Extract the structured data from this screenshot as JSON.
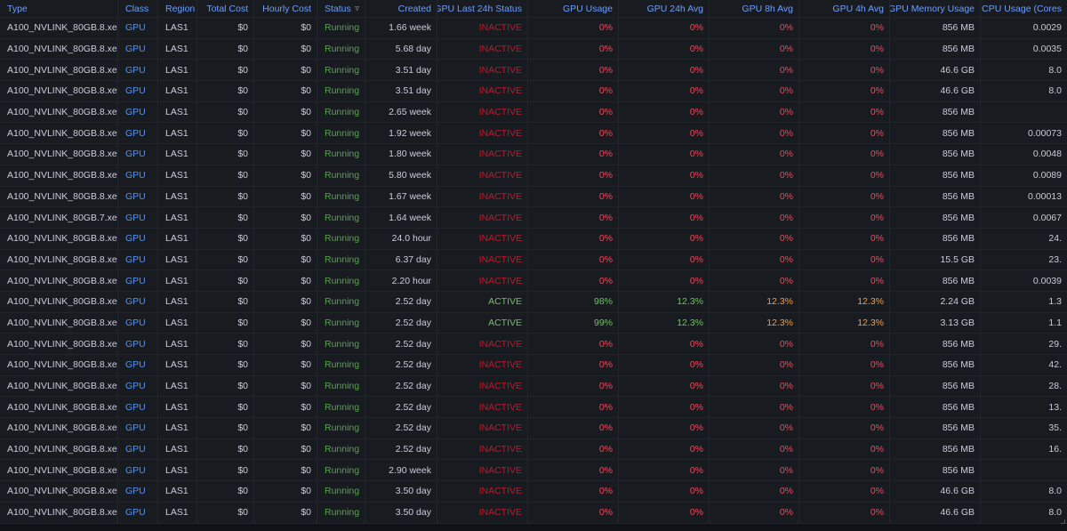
{
  "table": {
    "columns": [
      {
        "label": "Type",
        "filter": false
      },
      {
        "label": "Class",
        "filter": true
      },
      {
        "label": "Region",
        "filter": false
      },
      {
        "label": "Total Cost",
        "filter": false
      },
      {
        "label": "Hourly Cost",
        "filter": false
      },
      {
        "label": "Status",
        "filter": true
      },
      {
        "label": "Created",
        "filter": false
      },
      {
        "label": "GPU Last 24h Status",
        "filter": false
      },
      {
        "label": "GPU Usage",
        "filter": false
      },
      {
        "label": "GPU 24h Avg",
        "filter": false
      },
      {
        "label": "GPU 8h Avg",
        "filter": false
      },
      {
        "label": "GPU 4h Avg",
        "filter": false
      },
      {
        "label": "GPU Memory Usage",
        "filter": false
      },
      {
        "label": "CPU Usage (Cores",
        "filter": false
      }
    ],
    "colors": {
      "class": "#5794f2",
      "running": "#56a64b",
      "active": "#73bf69",
      "inactive": "#c4162a",
      "zero": "#f2495c",
      "mid": "#ff9830",
      "header": "#6e9fff"
    },
    "rows": [
      {
        "type": "A100_NVLINK_80GB.8.xe...",
        "class": "GPU",
        "region": "LAS1",
        "total_cost": "$0",
        "hourly_cost": "$0",
        "status": "Running",
        "created": "1.66 week",
        "gpu_status": "INACTIVE",
        "gpu_usage": "0%",
        "gpu_24h": "0%",
        "gpu_8h": "0%",
        "gpu_4h": "0%",
        "gpu_mem": "856 MB",
        "cpu": "0.0029"
      },
      {
        "type": "A100_NVLINK_80GB.8.xe...",
        "class": "GPU",
        "region": "LAS1",
        "total_cost": "$0",
        "hourly_cost": "$0",
        "status": "Running",
        "created": "5.68 day",
        "gpu_status": "INACTIVE",
        "gpu_usage": "0%",
        "gpu_24h": "0%",
        "gpu_8h": "0%",
        "gpu_4h": "0%",
        "gpu_mem": "856 MB",
        "cpu": "0.0035"
      },
      {
        "type": "A100_NVLINK_80GB.8.xe...",
        "class": "GPU",
        "region": "LAS1",
        "total_cost": "$0",
        "hourly_cost": "$0",
        "status": "Running",
        "created": "3.51 day",
        "gpu_status": "INACTIVE",
        "gpu_usage": "0%",
        "gpu_24h": "0%",
        "gpu_8h": "0%",
        "gpu_4h": "0%",
        "gpu_mem": "46.6 GB",
        "cpu": "8.0"
      },
      {
        "type": "A100_NVLINK_80GB.8.xe...",
        "class": "GPU",
        "region": "LAS1",
        "total_cost": "$0",
        "hourly_cost": "$0",
        "status": "Running",
        "created": "3.51 day",
        "gpu_status": "INACTIVE",
        "gpu_usage": "0%",
        "gpu_24h": "0%",
        "gpu_8h": "0%",
        "gpu_4h": "0%",
        "gpu_mem": "46.6 GB",
        "cpu": "8.0"
      },
      {
        "type": "A100_NVLINK_80GB.8.xe...",
        "class": "GPU",
        "region": "LAS1",
        "total_cost": "$0",
        "hourly_cost": "$0",
        "status": "Running",
        "created": "2.65 week",
        "gpu_status": "INACTIVE",
        "gpu_usage": "0%",
        "gpu_24h": "0%",
        "gpu_8h": "0%",
        "gpu_4h": "0%",
        "gpu_mem": "856 MB",
        "cpu": ""
      },
      {
        "type": "A100_NVLINK_80GB.8.xe...",
        "class": "GPU",
        "region": "LAS1",
        "total_cost": "$0",
        "hourly_cost": "$0",
        "status": "Running",
        "created": "1.92 week",
        "gpu_status": "INACTIVE",
        "gpu_usage": "0%",
        "gpu_24h": "0%",
        "gpu_8h": "0%",
        "gpu_4h": "0%",
        "gpu_mem": "856 MB",
        "cpu": "0.00073"
      },
      {
        "type": "A100_NVLINK_80GB.8.xe...",
        "class": "GPU",
        "region": "LAS1",
        "total_cost": "$0",
        "hourly_cost": "$0",
        "status": "Running",
        "created": "1.80 week",
        "gpu_status": "INACTIVE",
        "gpu_usage": "0%",
        "gpu_24h": "0%",
        "gpu_8h": "0%",
        "gpu_4h": "0%",
        "gpu_mem": "856 MB",
        "cpu": "0.0048"
      },
      {
        "type": "A100_NVLINK_80GB.8.xe...",
        "class": "GPU",
        "region": "LAS1",
        "total_cost": "$0",
        "hourly_cost": "$0",
        "status": "Running",
        "created": "5.80 week",
        "gpu_status": "INACTIVE",
        "gpu_usage": "0%",
        "gpu_24h": "0%",
        "gpu_8h": "0%",
        "gpu_4h": "0%",
        "gpu_mem": "856 MB",
        "cpu": "0.0089"
      },
      {
        "type": "A100_NVLINK_80GB.8.xe...",
        "class": "GPU",
        "region": "LAS1",
        "total_cost": "$0",
        "hourly_cost": "$0",
        "status": "Running",
        "created": "1.67 week",
        "gpu_status": "INACTIVE",
        "gpu_usage": "0%",
        "gpu_24h": "0%",
        "gpu_8h": "0%",
        "gpu_4h": "0%",
        "gpu_mem": "856 MB",
        "cpu": "0.00013"
      },
      {
        "type": "A100_NVLINK_80GB.7.xe...",
        "class": "GPU",
        "region": "LAS1",
        "total_cost": "$0",
        "hourly_cost": "$0",
        "status": "Running",
        "created": "1.64 week",
        "gpu_status": "INACTIVE",
        "gpu_usage": "0%",
        "gpu_24h": "0%",
        "gpu_8h": "0%",
        "gpu_4h": "0%",
        "gpu_mem": "856 MB",
        "cpu": "0.0067"
      },
      {
        "type": "A100_NVLINK_80GB.8.xe...",
        "class": "GPU",
        "region": "LAS1",
        "total_cost": "$0",
        "hourly_cost": "$0",
        "status": "Running",
        "created": "24.0 hour",
        "gpu_status": "INACTIVE",
        "gpu_usage": "0%",
        "gpu_24h": "0%",
        "gpu_8h": "0%",
        "gpu_4h": "0%",
        "gpu_mem": "856 MB",
        "cpu": "24."
      },
      {
        "type": "A100_NVLINK_80GB.8.xe...",
        "class": "GPU",
        "region": "LAS1",
        "total_cost": "$0",
        "hourly_cost": "$0",
        "status": "Running",
        "created": "6.37 day",
        "gpu_status": "INACTIVE",
        "gpu_usage": "0%",
        "gpu_24h": "0%",
        "gpu_8h": "0%",
        "gpu_4h": "0%",
        "gpu_mem": "15.5 GB",
        "cpu": "23."
      },
      {
        "type": "A100_NVLINK_80GB.8.xe...",
        "class": "GPU",
        "region": "LAS1",
        "total_cost": "$0",
        "hourly_cost": "$0",
        "status": "Running",
        "created": "2.20 hour",
        "gpu_status": "INACTIVE",
        "gpu_usage": "0%",
        "gpu_24h": "0%",
        "gpu_8h": "0%",
        "gpu_4h": "0%",
        "gpu_mem": "856 MB",
        "cpu": "0.0039"
      },
      {
        "type": "A100_NVLINK_80GB.8.xe...",
        "class": "GPU",
        "region": "LAS1",
        "total_cost": "$0",
        "hourly_cost": "$0",
        "status": "Running",
        "created": "2.52 day",
        "gpu_status": "ACTIVE",
        "gpu_usage": "98%",
        "gpu_24h": "12.3%",
        "gpu_8h": "12.3%",
        "gpu_4h": "12.3%",
        "gpu_mem": "2.24 GB",
        "cpu": "1.3"
      },
      {
        "type": "A100_NVLINK_80GB.8.xe...",
        "class": "GPU",
        "region": "LAS1",
        "total_cost": "$0",
        "hourly_cost": "$0",
        "status": "Running",
        "created": "2.52 day",
        "gpu_status": "ACTIVE",
        "gpu_usage": "99%",
        "gpu_24h": "12.3%",
        "gpu_8h": "12.3%",
        "gpu_4h": "12.3%",
        "gpu_mem": "3.13 GB",
        "cpu": "1.1"
      },
      {
        "type": "A100_NVLINK_80GB.8.xe...",
        "class": "GPU",
        "region": "LAS1",
        "total_cost": "$0",
        "hourly_cost": "$0",
        "status": "Running",
        "created": "2.52 day",
        "gpu_status": "INACTIVE",
        "gpu_usage": "0%",
        "gpu_24h": "0%",
        "gpu_8h": "0%",
        "gpu_4h": "0%",
        "gpu_mem": "856 MB",
        "cpu": "29."
      },
      {
        "type": "A100_NVLINK_80GB.8.xe...",
        "class": "GPU",
        "region": "LAS1",
        "total_cost": "$0",
        "hourly_cost": "$0",
        "status": "Running",
        "created": "2.52 day",
        "gpu_status": "INACTIVE",
        "gpu_usage": "0%",
        "gpu_24h": "0%",
        "gpu_8h": "0%",
        "gpu_4h": "0%",
        "gpu_mem": "856 MB",
        "cpu": "42."
      },
      {
        "type": "A100_NVLINK_80GB.8.xe...",
        "class": "GPU",
        "region": "LAS1",
        "total_cost": "$0",
        "hourly_cost": "$0",
        "status": "Running",
        "created": "2.52 day",
        "gpu_status": "INACTIVE",
        "gpu_usage": "0%",
        "gpu_24h": "0%",
        "gpu_8h": "0%",
        "gpu_4h": "0%",
        "gpu_mem": "856 MB",
        "cpu": "28."
      },
      {
        "type": "A100_NVLINK_80GB.8.xe...",
        "class": "GPU",
        "region": "LAS1",
        "total_cost": "$0",
        "hourly_cost": "$0",
        "status": "Running",
        "created": "2.52 day",
        "gpu_status": "INACTIVE",
        "gpu_usage": "0%",
        "gpu_24h": "0%",
        "gpu_8h": "0%",
        "gpu_4h": "0%",
        "gpu_mem": "856 MB",
        "cpu": "13."
      },
      {
        "type": "A100_NVLINK_80GB.8.xe...",
        "class": "GPU",
        "region": "LAS1",
        "total_cost": "$0",
        "hourly_cost": "$0",
        "status": "Running",
        "created": "2.52 day",
        "gpu_status": "INACTIVE",
        "gpu_usage": "0%",
        "gpu_24h": "0%",
        "gpu_8h": "0%",
        "gpu_4h": "0%",
        "gpu_mem": "856 MB",
        "cpu": "35."
      },
      {
        "type": "A100_NVLINK_80GB.8.xe...",
        "class": "GPU",
        "region": "LAS1",
        "total_cost": "$0",
        "hourly_cost": "$0",
        "status": "Running",
        "created": "2.52 day",
        "gpu_status": "INACTIVE",
        "gpu_usage": "0%",
        "gpu_24h": "0%",
        "gpu_8h": "0%",
        "gpu_4h": "0%",
        "gpu_mem": "856 MB",
        "cpu": "16."
      },
      {
        "type": "A100_NVLINK_80GB.8.xe...",
        "class": "GPU",
        "region": "LAS1",
        "total_cost": "$0",
        "hourly_cost": "$0",
        "status": "Running",
        "created": "2.90 week",
        "gpu_status": "INACTIVE",
        "gpu_usage": "0%",
        "gpu_24h": "0%",
        "gpu_8h": "0%",
        "gpu_4h": "0%",
        "gpu_mem": "856 MB",
        "cpu": ""
      },
      {
        "type": "A100_NVLINK_80GB.8.xe...",
        "class": "GPU",
        "region": "LAS1",
        "total_cost": "$0",
        "hourly_cost": "$0",
        "status": "Running",
        "created": "3.50 day",
        "gpu_status": "INACTIVE",
        "gpu_usage": "0%",
        "gpu_24h": "0%",
        "gpu_8h": "0%",
        "gpu_4h": "0%",
        "gpu_mem": "46.6 GB",
        "cpu": "8.0"
      },
      {
        "type": "A100_NVLINK_80GB.8.xe...",
        "class": "GPU",
        "region": "LAS1",
        "total_cost": "$0",
        "hourly_cost": "$0",
        "status": "Running",
        "created": "3.50 day",
        "gpu_status": "INACTIVE",
        "gpu_usage": "0%",
        "gpu_24h": "0%",
        "gpu_8h": "0%",
        "gpu_4h": "0%",
        "gpu_mem": "46.6 GB",
        "cpu": "8.0"
      }
    ]
  }
}
